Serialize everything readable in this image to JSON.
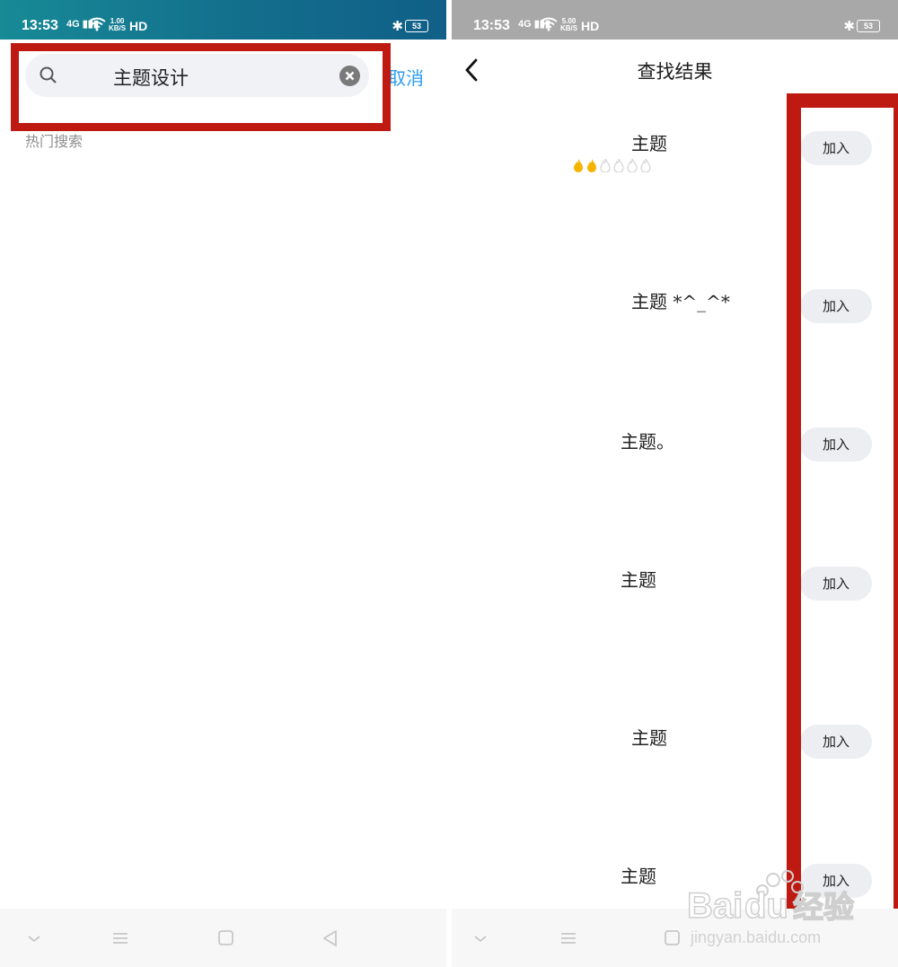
{
  "left_screen": {
    "status": {
      "time": "13:53",
      "network": "4G",
      "speed_top": "1.00",
      "speed_unit": "KB/S",
      "hd": "HD",
      "battery": "53"
    },
    "search": {
      "value": "主题设计",
      "cancel_label": "取消"
    },
    "hot_search_label": "热门搜索"
  },
  "right_screen": {
    "status": {
      "time": "13:53",
      "network": "4G",
      "speed_top": "5.00",
      "speed_unit": "KB/S",
      "hd": "HD",
      "battery": "53"
    },
    "title": "查找结果",
    "results": [
      {
        "name": "主题",
        "join": "加入",
        "fire_level": 2,
        "fire_total": 6
      },
      {
        "name": "主题 *^_^*",
        "join": "加入"
      },
      {
        "name": "主题。",
        "join": "加入"
      },
      {
        "name": "主题",
        "join": "加入"
      },
      {
        "name": "主题",
        "join": "加入"
      },
      {
        "name": "主题",
        "join": "加入"
      }
    ]
  },
  "watermark": {
    "brand": "Baidu",
    "brand_cn": "经验",
    "url": "jingyan.baidu.com"
  },
  "colors": {
    "accent_blue": "#2a9cf2",
    "annotation_red": "#be1a11",
    "status_left": "#136e8c",
    "status_right": "#a8a8a8"
  },
  "icons": [
    "search-icon",
    "clear-icon",
    "back-icon",
    "fire-icon",
    "wifi-icon",
    "bluetooth-icon",
    "battery-icon",
    "nav-back-icon",
    "nav-home-icon",
    "nav-menu-icon",
    "nav-down-icon"
  ]
}
